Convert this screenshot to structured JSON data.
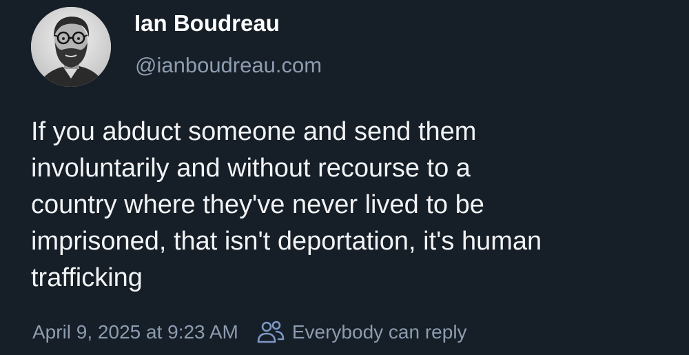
{
  "author": {
    "display_name": "Ian Boudreau",
    "handle": "@ianboudreau.com",
    "avatar_icon": "profile-photo"
  },
  "post": {
    "text": "If you abduct someone and send them\ninvoluntarily and without recourse to a\ncountry where they've never lived to be\nimprisoned, that isn't deportation, it's human\ntrafficking"
  },
  "meta": {
    "timestamp": "April 9, 2025 at 9:23 AM",
    "reply_setting": "Everybody can reply",
    "reply_icon": "people-icon"
  },
  "colors": {
    "background": "#161e27",
    "primary_text": "#ffffff",
    "secondary_text": "#8d9cb0",
    "accent": "#7d98c4"
  }
}
